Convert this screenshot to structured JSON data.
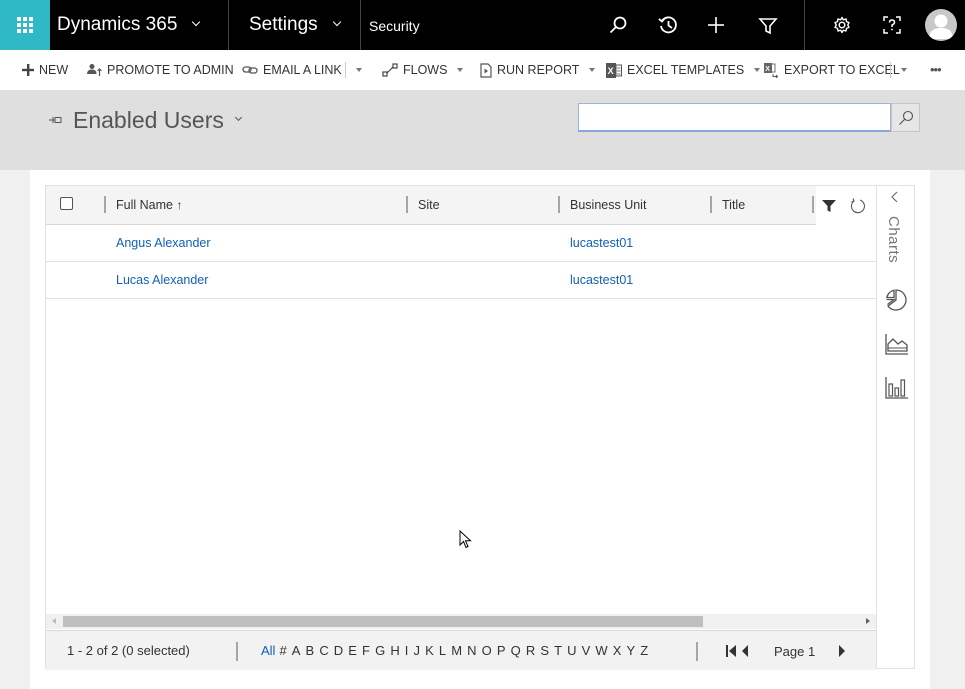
{
  "topbar": {
    "app_name": "Dynamics 365",
    "area_name": "Settings",
    "breadcrumb": "Security",
    "icons": [
      "search-icon",
      "recent-icon",
      "new-record-icon",
      "advanced-find-icon",
      "settings-gear-icon",
      "help-icon",
      "user-avatar"
    ],
    "brand_color": "#2fb8c6"
  },
  "commandbar": {
    "new": "NEW",
    "promote_to_admin": "PROMOTE TO ADMIN",
    "email_a_link": "EMAIL A LINK",
    "flows": "FLOWS",
    "run_report": "RUN REPORT",
    "excel_templates": "EXCEL TEMPLATES",
    "export_to_excel": "EXPORT TO EXCEL",
    "more": "•••"
  },
  "header": {
    "view_title": "Enabled Users",
    "search_value": "",
    "search_placeholder": ""
  },
  "grid": {
    "columns": [
      {
        "label": "Full Name",
        "sorted": "ascending",
        "sort_glyph": "↑"
      },
      {
        "label": "Site"
      },
      {
        "label": "Business Unit"
      },
      {
        "label": "Title"
      }
    ],
    "rows": [
      {
        "full_name": "Angus Alexander",
        "site": "",
        "business_unit": "lucastest01",
        "title": ""
      },
      {
        "full_name": "Lucas Alexander",
        "site": "",
        "business_unit": "lucastest01",
        "title": ""
      }
    ],
    "link_color": "#1160b7"
  },
  "charts_pane": {
    "label": "Charts",
    "icons": [
      "pie-chart-icon",
      "area-chart-icon",
      "column-chart-icon"
    ]
  },
  "footer": {
    "record_count": "1 - 2 of 2 (0 selected)",
    "alpha_filters": [
      "All",
      "#",
      "A",
      "B",
      "C",
      "D",
      "E",
      "F",
      "G",
      "H",
      "I",
      "J",
      "K",
      "L",
      "M",
      "N",
      "O",
      "P",
      "Q",
      "R",
      "S",
      "T",
      "U",
      "V",
      "W",
      "X",
      "Y",
      "Z"
    ],
    "alpha_active": "All",
    "page_label": "Page 1"
  }
}
